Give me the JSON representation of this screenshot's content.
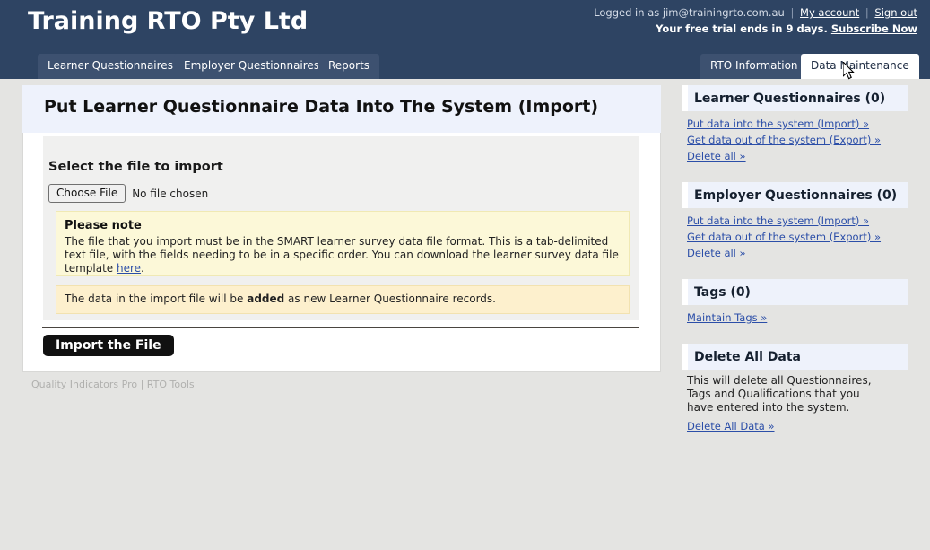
{
  "header": {
    "brand": "Training RTO Pty Ltd",
    "logged_in_prefix": "Logged in as",
    "user_email": "jim@trainingrto.com.au",
    "my_account_label": "My account",
    "sign_out_label": "Sign out",
    "trial_text": "Your free trial ends in 9 days.",
    "subscribe_label": "Subscribe Now",
    "accent_color": "#2e4463"
  },
  "nav": {
    "left_tabs": [
      {
        "label": "Learner Questionnaires",
        "active": false
      },
      {
        "label": "Employer Questionnaires",
        "active": false
      },
      {
        "label": "Reports",
        "active": false
      }
    ],
    "right_tabs": [
      {
        "label": "RTO Information",
        "active": false
      },
      {
        "label": "Data Maintenance",
        "active": true
      }
    ]
  },
  "main": {
    "page_title": "Put Learner Questionnaire Data Into The System (Import)",
    "select_file_label": "Select the file to import",
    "choose_file_button": "Choose File",
    "no_file_text": "No file chosen",
    "note": {
      "title": "Please note",
      "body_part1": "The file that you import must be in the SMART learner survey data file format. This is a tab-delimited text file, with the fields needing to be in a specific order. You can download the learner survey data file template ",
      "link_label": "here",
      "body_part2": "."
    },
    "added_note": {
      "prefix": "The data in the import file will be ",
      "emphasis": "added",
      "suffix": " as new Learner Questionnaire records."
    },
    "import_button": "Import the File",
    "footer": "Quality Indicators Pro | RTO Tools"
  },
  "sidebar": {
    "panels": [
      {
        "title": "Learner Questionnaires (0)",
        "links": [
          "Put data into the system (Import) »",
          "Get data out of the system (Export) »",
          "Delete all »"
        ],
        "description": ""
      },
      {
        "title": "Employer Questionnaires (0)",
        "links": [
          "Put data into the system (Import) »",
          "Get data out of the system (Export) »",
          "Delete all »"
        ],
        "description": ""
      },
      {
        "title": "Tags (0)",
        "links": [
          "Maintain Tags »"
        ],
        "description": ""
      },
      {
        "title": "Delete All Data",
        "links": [
          "Delete All Data »"
        ],
        "description": "This will delete all Questionnaires, Tags and Qualifications that you have entered into the system."
      }
    ]
  }
}
